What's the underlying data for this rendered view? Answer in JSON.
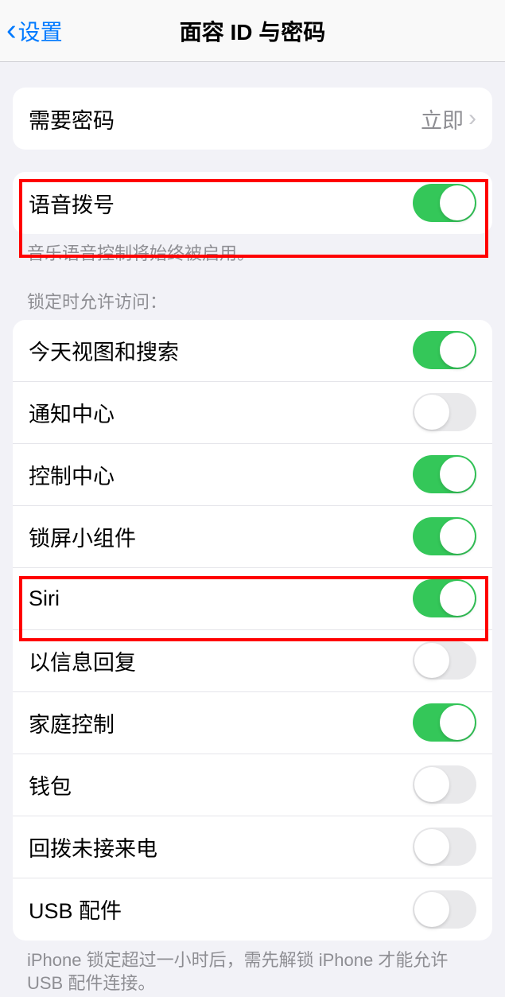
{
  "nav": {
    "back_label": "设置",
    "title": "面容 ID 与密码"
  },
  "require_passcode": {
    "label": "需要密码",
    "value": "立即"
  },
  "voice_dial": {
    "label": "语音拨号",
    "footer": "音乐语音控制将始终被启用。"
  },
  "allow_access_header": "锁定时允许访问：",
  "allow_access": {
    "items": [
      {
        "label": "今天视图和搜索",
        "on": true
      },
      {
        "label": "通知中心",
        "on": false
      },
      {
        "label": "控制中心",
        "on": true
      },
      {
        "label": "锁屏小组件",
        "on": true
      },
      {
        "label": "Siri",
        "on": true
      },
      {
        "label": "以信息回复",
        "on": false
      },
      {
        "label": "家庭控制",
        "on": true
      },
      {
        "label": "钱包",
        "on": false
      },
      {
        "label": "回拨未接来电",
        "on": false
      },
      {
        "label": "USB 配件",
        "on": false
      }
    ]
  },
  "usb_footer": "iPhone 锁定超过一小时后，需先解锁 iPhone 才能允许 USB 配件连接。"
}
